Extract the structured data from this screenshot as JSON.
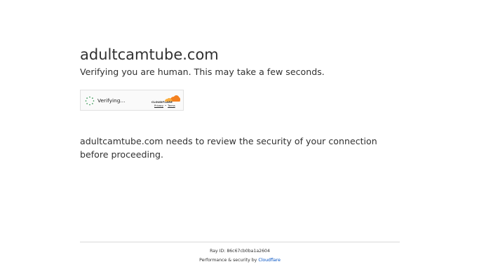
{
  "header": {
    "domain": "adultcamtube.com",
    "subtitle": "Verifying you are human. This may take a few seconds."
  },
  "challenge_widget": {
    "status_text": "Verifying...",
    "brand": "CLOUDFLARE",
    "privacy_label": "Privacy",
    "separator": "•",
    "terms_label": "Terms",
    "brand_color": "#f38020",
    "spinner_icon": "loading-spinner-icon"
  },
  "notice": {
    "text": "adultcamtube.com needs to review the security of your connection before proceeding."
  },
  "footer": {
    "ray_label": "Ray ID:",
    "ray_id": "86c67cb0ba1a2604",
    "perf_label": "Performance & security by",
    "perf_link": "Cloudflare",
    "link_color": "#0051c3"
  }
}
